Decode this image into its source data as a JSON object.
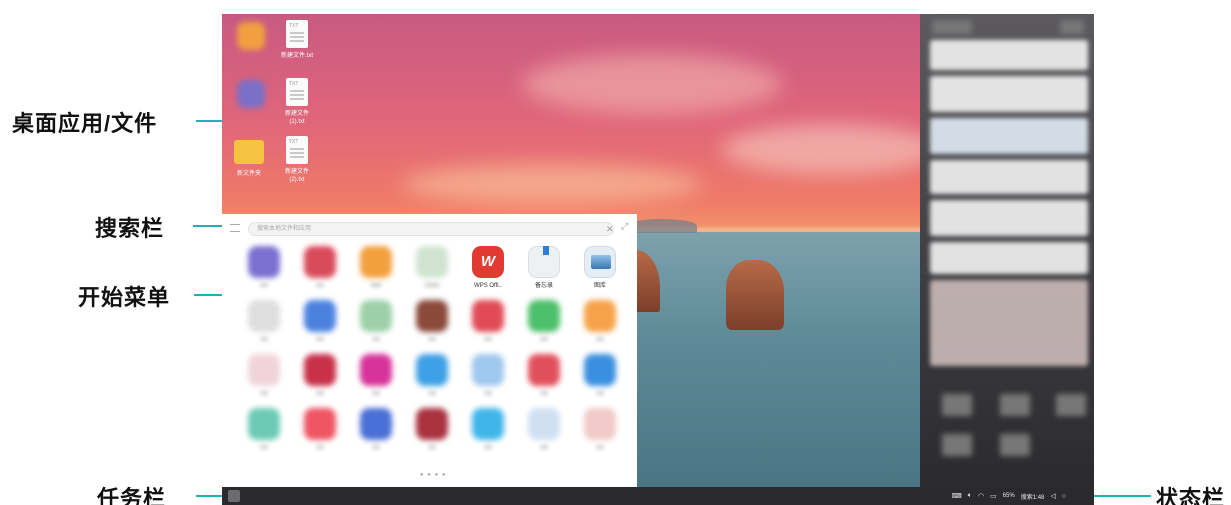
{
  "callouts": {
    "desktop": "桌面应用/文件",
    "search": "搜索栏",
    "start_menu": "开始菜单",
    "taskbar": "任务栏",
    "status_bar": "状态栏"
  },
  "desktop": {
    "items": [
      {
        "label": "",
        "icon": "app-icon"
      },
      {
        "label": "新建文件.txt",
        "ext": "TXT",
        "icon": "text-file-icon"
      },
      {
        "label": "",
        "icon": "app-icon"
      },
      {
        "label": "新建文件\n(1).txt",
        "ext": "TXT",
        "icon": "text-file-icon"
      },
      {
        "label": "新文件夹",
        "icon": "folder-icon"
      },
      {
        "label": "新建文件\n(2).txt",
        "ext": "TXT",
        "icon": "text-file-icon"
      }
    ]
  },
  "start_menu": {
    "search_placeholder": "搜索本地文件和应用",
    "page_indicator": "● ● ● ●",
    "visible_apps": [
      {
        "label": "WPS Offi..",
        "icon": "wps-icon",
        "color": "#e03a31"
      },
      {
        "label": "备忘录",
        "icon": "memo-icon",
        "color": "#2d7fd8"
      },
      {
        "label": "图库",
        "icon": "gallery-icon",
        "color": "#3a77b5"
      }
    ]
  },
  "status": {
    "battery": "65%",
    "time": "搜索1:48"
  },
  "colors": {
    "accent": "#20b0b8",
    "taskbar": "#2a2a2e",
    "start_menu_bg": "#ffffff"
  }
}
